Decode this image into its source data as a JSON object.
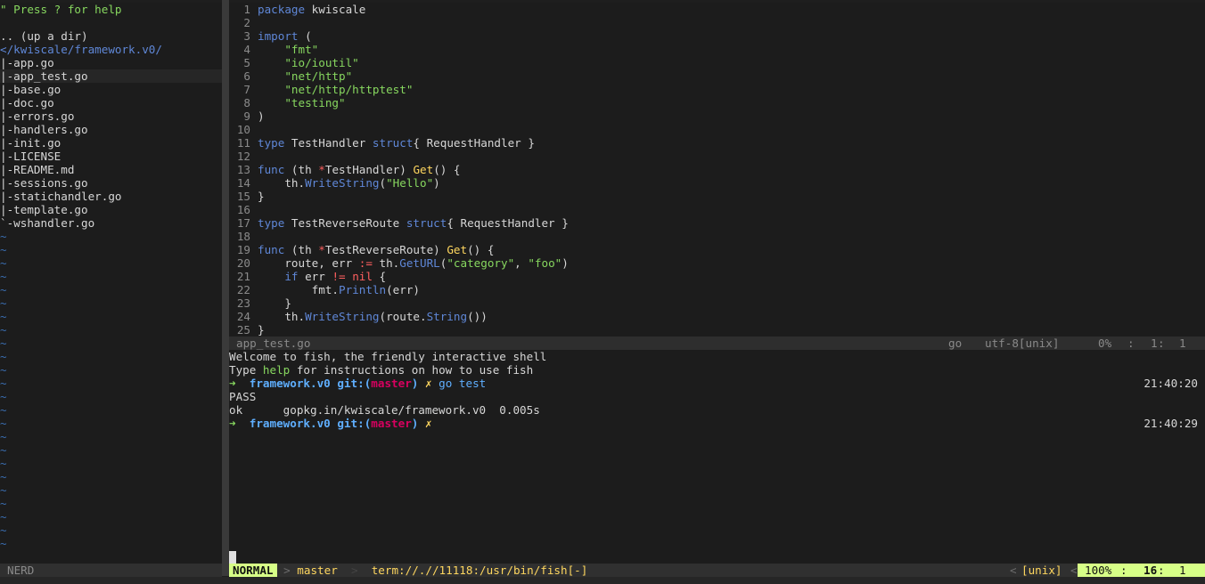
{
  "nerdtree": {
    "help_hint": "\" Press ? for help",
    "up_dir": ".. (up a dir)",
    "root": "</kwiscale/framework.v0/",
    "files": [
      "|-app.go",
      "|-app_test.go",
      "|-base.go",
      "|-doc.go",
      "|-errors.go",
      "|-handlers.go",
      "|-init.go",
      "|-LICENSE",
      "|-README.md",
      "|-sessions.go",
      "|-statichandler.go",
      "|-template.go",
      "`-wshandler.go"
    ],
    "tilde": "~",
    "status": "NERD"
  },
  "editor": {
    "lines": [
      {
        "n": "1",
        "t": "package kwiscale"
      },
      {
        "n": "2",
        "t": ""
      },
      {
        "n": "3",
        "t": "import ("
      },
      {
        "n": "4",
        "t": "    \"fmt\""
      },
      {
        "n": "5",
        "t": "    \"io/ioutil\""
      },
      {
        "n": "6",
        "t": "    \"net/http\""
      },
      {
        "n": "7",
        "t": "    \"net/http/httptest\""
      },
      {
        "n": "8",
        "t": "    \"testing\""
      },
      {
        "n": "9",
        "t": ")"
      },
      {
        "n": "10",
        "t": ""
      },
      {
        "n": "11",
        "t": "type TestHandler struct{ RequestHandler }"
      },
      {
        "n": "12",
        "t": ""
      },
      {
        "n": "13",
        "t": "func (th *TestHandler) Get() {"
      },
      {
        "n": "14",
        "t": "    th.WriteString(\"Hello\")"
      },
      {
        "n": "15",
        "t": "}"
      },
      {
        "n": "16",
        "t": ""
      },
      {
        "n": "17",
        "t": "type TestReverseRoute struct{ RequestHandler }"
      },
      {
        "n": "18",
        "t": ""
      },
      {
        "n": "19",
        "t": "func (th *TestReverseRoute) Get() {"
      },
      {
        "n": "20",
        "t": "    route, err := th.GetURL(\"category\", \"foo\")"
      },
      {
        "n": "21",
        "t": "    if err != nil {"
      },
      {
        "n": "22",
        "t": "        fmt.Println(err)"
      },
      {
        "n": "23",
        "t": "    }"
      },
      {
        "n": "24",
        "t": "    th.WriteString(route.String())"
      },
      {
        "n": "25",
        "t": "}"
      }
    ],
    "status": {
      "filename": "app_test.go",
      "filetype": "go",
      "encoding": "utf-8[unix]",
      "percent": "0%",
      "line": "1",
      "col": "1"
    }
  },
  "terminal": {
    "welcome1": "Welcome to fish, the friendly interactive shell",
    "welcome2_a": "Type ",
    "welcome2_help": "help",
    "welcome2_b": " for instructions on how to use fish",
    "prompt_arrow": "➜",
    "prompt_dir": "framework.v0",
    "prompt_git": "git:(",
    "prompt_branch": "master",
    "prompt_git_close": ")",
    "prompt_dirty": "✗",
    "command": "go test",
    "time1": "21:40:20",
    "out1": "PASS",
    "out2": "ok      gopkg.in/kwiscale/framework.v0  0.005s",
    "time2": "21:40:29"
  },
  "statusline": {
    "mode": "NORMAL",
    "branch_sep": ">",
    "branch": "master",
    "path_sep": ">",
    "path": "term://.//11118:/usr/bin/fish[-]",
    "lt1": "<",
    "format": "[unix]",
    "lt2": "<",
    "percent": "100%",
    "line": "16",
    "col": "1"
  },
  "colors": {
    "mode_bg": "#d7ff87",
    "keyword": "#5f87d7",
    "string": "#87d75f",
    "function": "#ffd75f",
    "branch": "#d7005f"
  }
}
